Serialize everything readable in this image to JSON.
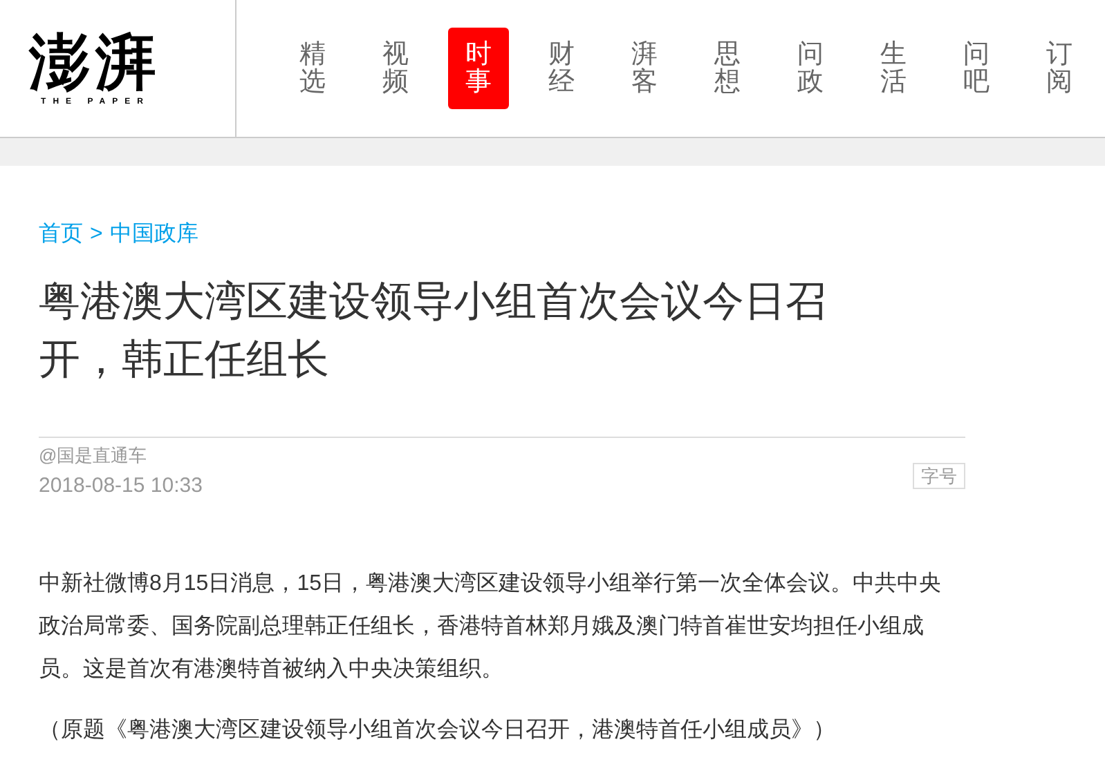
{
  "logo": {
    "mark": "澎湃",
    "tagline": "THE PAPER"
  },
  "nav": [
    {
      "label": "精选",
      "selected": false
    },
    {
      "label": "视频",
      "selected": false
    },
    {
      "label": "时事",
      "selected": true
    },
    {
      "label": "财经",
      "selected": false
    },
    {
      "label": "湃客",
      "selected": false
    },
    {
      "label": "思想",
      "selected": false
    },
    {
      "label": "问政",
      "selected": false
    },
    {
      "label": "生活",
      "selected": false
    },
    {
      "label": "问吧",
      "selected": false
    },
    {
      "label": "订阅",
      "selected": false
    }
  ],
  "breadcrumb": [
    {
      "label": "首页"
    },
    {
      "label": "中国政库"
    }
  ],
  "breadcrumb_separator": ">",
  "article": {
    "title": "粤港澳大湾区建设领导小组首次会议今日召开，韩正任组长",
    "author": "@国是直通车",
    "date": "2018-08-15 10:33",
    "font_size_button": "字号",
    "paragraphs": [
      "中新社微博8月15日消息，15日，粤港澳大湾区建设领导小组举行第一次全体会议。中共中央政治局常委、国务院副总理韩正任组长，香港特首林郑月娥及澳门特首崔世安均担任小组成员。这是首次有港澳特首被纳入中央决策组织。"
    ],
    "note": "（原题《粤港澳大湾区建设领导小组首次会议今日召开，港澳特首任小组成员》）"
  }
}
